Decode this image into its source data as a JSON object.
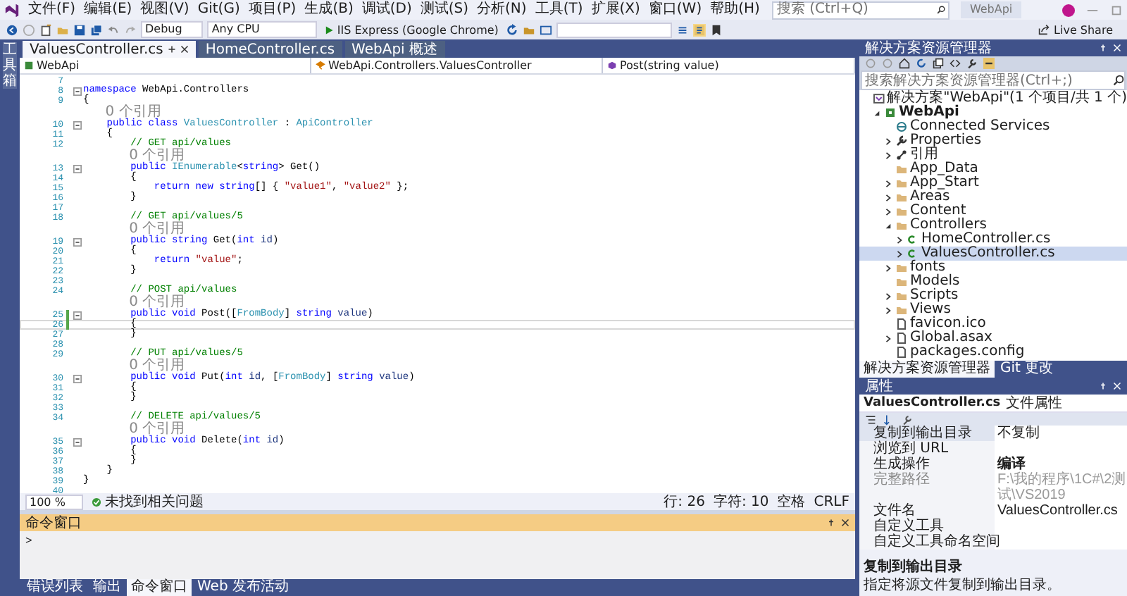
{
  "menu": [
    "文件(F)",
    "编辑(E)",
    "视图(V)",
    "Git(G)",
    "项目(P)",
    "生成(B)",
    "调试(D)",
    "测试(S)",
    "分析(N)",
    "工具(T)",
    "扩展(X)",
    "窗口(W)",
    "帮助(H)"
  ],
  "search": {
    "placeholder": "搜索 (Ctrl+Q)"
  },
  "window": {
    "title": "WebApi"
  },
  "toolbar": {
    "configuration": "Debug",
    "platform": "Any CPU",
    "run_target": "IIS Express (Google Chrome)",
    "live_share": "Live Share"
  },
  "side_tab": "工具箱",
  "tabs": [
    {
      "label": "ValuesController.cs",
      "selected": true
    },
    {
      "label": "HomeController.cs",
      "selected": false
    },
    {
      "label": "WebApi 概述",
      "selected": false
    }
  ],
  "nav": {
    "project": "WebApi",
    "type": "WebApi.Controllers.ValuesController",
    "member": "Post(string value)"
  },
  "code": [
    {
      "kind": "code",
      "number": "7",
      "fold": false,
      "changed": false,
      "current": false
    },
    {
      "kind": "code",
      "number": "8",
      "fold": true,
      "changed": false,
      "current": false,
      "parts": [
        {
          "kind": "keyword",
          "text": "namespace"
        },
        {
          "kind": "plain",
          "text": " WebApi.Controllers"
        }
      ]
    },
    {
      "kind": "code",
      "number": "9",
      "fold": false,
      "changed": false,
      "current": false,
      "parts": [
        {
          "kind": "plain",
          "text": "{"
        }
      ]
    },
    {
      "kind": "lens",
      "text": "0 个引用"
    },
    {
      "kind": "code",
      "number": "10",
      "fold": true,
      "changed": false,
      "current": false,
      "parts": [
        {
          "kind": "keyword",
          "text": "public class "
        },
        {
          "kind": "type",
          "text": "ValuesController"
        },
        {
          "kind": "plain",
          "text": " : "
        },
        {
          "kind": "type",
          "text": "ApiController"
        }
      ]
    },
    {
      "kind": "code",
      "number": "11",
      "fold": false,
      "changed": false,
      "current": false,
      "parts": [
        {
          "kind": "plain",
          "text": "{"
        }
      ]
    },
    {
      "kind": "code",
      "number": "12",
      "fold": false,
      "changed": false,
      "current": false,
      "parts": [
        {
          "kind": "comment",
          "text": "// GET api/values"
        }
      ]
    },
    {
      "kind": "lens",
      "text": "0 个引用"
    },
    {
      "kind": "code",
      "number": "13",
      "fold": true,
      "changed": false,
      "current": false,
      "parts": [
        {
          "kind": "keyword",
          "text": "public "
        },
        {
          "kind": "type",
          "text": "IEnumerable"
        },
        {
          "kind": "plain",
          "text": "<"
        },
        {
          "kind": "keyword",
          "text": "string"
        },
        {
          "kind": "plain",
          "text": "> Get()"
        }
      ]
    },
    {
      "kind": "code",
      "number": "14",
      "fold": false,
      "changed": false,
      "current": false,
      "parts": [
        {
          "kind": "plain",
          "text": "{"
        }
      ]
    },
    {
      "kind": "code",
      "number": "15",
      "fold": false,
      "changed": false,
      "current": false,
      "parts": [
        {
          "kind": "keyword",
          "text": "return new string"
        },
        {
          "kind": "plain",
          "text": "[] { "
        },
        {
          "kind": "string",
          "text": "\"value1\""
        },
        {
          "kind": "plain",
          "text": ", "
        },
        {
          "kind": "string",
          "text": "\"value2\""
        },
        {
          "kind": "plain",
          "text": " };"
        }
      ]
    },
    {
      "kind": "code",
      "number": "16",
      "fold": false,
      "changed": false,
      "current": false,
      "parts": [
        {
          "kind": "plain",
          "text": "}"
        }
      ]
    },
    {
      "kind": "code",
      "number": "17",
      "fold": false,
      "changed": false,
      "current": false
    },
    {
      "kind": "code",
      "number": "18",
      "fold": false,
      "changed": false,
      "current": false,
      "parts": [
        {
          "kind": "comment",
          "text": "// GET api/values/5"
        }
      ]
    },
    {
      "kind": "lens",
      "text": "0 个引用"
    },
    {
      "kind": "code",
      "number": "19",
      "fold": true,
      "changed": false,
      "current": false,
      "parts": [
        {
          "kind": "keyword",
          "text": "public string "
        },
        {
          "kind": "plain",
          "text": "Get("
        },
        {
          "kind": "keyword",
          "text": "int "
        },
        {
          "kind": "param",
          "text": "id"
        },
        {
          "kind": "plain",
          "text": ")"
        }
      ]
    },
    {
      "kind": "code",
      "number": "20",
      "fold": false,
      "changed": false,
      "current": false,
      "parts": [
        {
          "kind": "plain",
          "text": "{"
        }
      ]
    },
    {
      "kind": "code",
      "number": "21",
      "fold": false,
      "changed": false,
      "current": false,
      "parts": [
        {
          "kind": "keyword",
          "text": "return "
        },
        {
          "kind": "string",
          "text": "\"value\""
        },
        {
          "kind": "plain",
          "text": ";"
        }
      ]
    },
    {
      "kind": "code",
      "number": "22",
      "fold": false,
      "changed": false,
      "current": false,
      "parts": [
        {
          "kind": "plain",
          "text": "}"
        }
      ]
    },
    {
      "kind": "code",
      "number": "23",
      "fold": false,
      "changed": false,
      "current": false
    },
    {
      "kind": "code",
      "number": "24",
      "fold": false,
      "changed": false,
      "current": false,
      "parts": [
        {
          "kind": "comment",
          "text": "// POST api/values"
        }
      ]
    },
    {
      "kind": "lens",
      "text": "0 个引用"
    },
    {
      "kind": "code",
      "number": "25",
      "fold": true,
      "changed": true,
      "current": false,
      "parts": [
        {
          "kind": "keyword",
          "text": "public void "
        },
        {
          "kind": "plain",
          "text": "Post(["
        },
        {
          "kind": "type",
          "text": "FromBody"
        },
        {
          "kind": "plain",
          "text": "] "
        },
        {
          "kind": "keyword",
          "text": "string "
        },
        {
          "kind": "param",
          "text": "value"
        },
        {
          "kind": "plain",
          "text": ")"
        }
      ]
    },
    {
      "kind": "code",
      "number": "26",
      "fold": false,
      "changed": true,
      "current": true,
      "parts": [
        {
          "kind": "plain",
          "text": "{"
        }
      ]
    },
    {
      "kind": "code",
      "number": "27",
      "fold": false,
      "changed": false,
      "current": false,
      "parts": [
        {
          "kind": "plain",
          "text": "}"
        }
      ]
    },
    {
      "kind": "code",
      "number": "28",
      "fold": false,
      "changed": false,
      "current": false
    },
    {
      "kind": "code",
      "number": "29",
      "fold": false,
      "changed": false,
      "current": false,
      "parts": [
        {
          "kind": "comment",
          "text": "// PUT api/values/5"
        }
      ]
    },
    {
      "kind": "lens",
      "text": "0 个引用"
    },
    {
      "kind": "code",
      "number": "30",
      "fold": true,
      "changed": false,
      "current": false,
      "parts": [
        {
          "kind": "keyword",
          "text": "public void "
        },
        {
          "kind": "plain",
          "text": "Put("
        },
        {
          "kind": "keyword",
          "text": "int "
        },
        {
          "kind": "param",
          "text": "id"
        },
        {
          "kind": "plain",
          "text": ", ["
        },
        {
          "kind": "type",
          "text": "FromBody"
        },
        {
          "kind": "plain",
          "text": "] "
        },
        {
          "kind": "keyword",
          "text": "string "
        },
        {
          "kind": "param",
          "text": "value"
        },
        {
          "kind": "plain",
          "text": ")"
        }
      ]
    },
    {
      "kind": "code",
      "number": "31",
      "fold": false,
      "changed": false,
      "current": false,
      "parts": [
        {
          "kind": "plain",
          "text": "{"
        }
      ]
    },
    {
      "kind": "code",
      "number": "32",
      "fold": false,
      "changed": false,
      "current": false,
      "parts": [
        {
          "kind": "plain",
          "text": "}"
        }
      ]
    },
    {
      "kind": "code",
      "number": "33",
      "fold": false,
      "changed": false,
      "current": false
    },
    {
      "kind": "code",
      "number": "34",
      "fold": false,
      "changed": false,
      "current": false,
      "parts": [
        {
          "kind": "comment",
          "text": "// DELETE api/values/5"
        }
      ]
    },
    {
      "kind": "lens",
      "text": "0 个引用"
    },
    {
      "kind": "code",
      "number": "35",
      "fold": true,
      "changed": false,
      "current": false,
      "parts": [
        {
          "kind": "keyword",
          "text": "public void "
        },
        {
          "kind": "plain",
          "text": "Delete("
        },
        {
          "kind": "keyword",
          "text": "int "
        },
        {
          "kind": "param",
          "text": "id"
        },
        {
          "kind": "plain",
          "text": ")"
        }
      ]
    },
    {
      "kind": "code",
      "number": "36",
      "fold": false,
      "changed": false,
      "current": false,
      "parts": [
        {
          "kind": "plain",
          "text": "{"
        }
      ]
    },
    {
      "kind": "code",
      "number": "37",
      "fold": false,
      "changed": false,
      "current": false,
      "parts": [
        {
          "kind": "plain",
          "text": "}"
        }
      ]
    },
    {
      "kind": "code",
      "number": "38",
      "fold": false,
      "changed": false,
      "current": false,
      "parts": [
        {
          "kind": "plain",
          "text": "}"
        }
      ]
    },
    {
      "kind": "code",
      "number": "39",
      "fold": false,
      "changed": false,
      "current": false,
      "parts": [
        {
          "kind": "plain",
          "text": "}"
        }
      ]
    },
    {
      "kind": "code",
      "number": "40",
      "fold": false,
      "changed": false,
      "current": false
    }
  ],
  "status": {
    "zoom": "100 %",
    "issues": "未找到相关问题",
    "line": "行: 26",
    "column": "字符: 10",
    "indent": "空格",
    "line_ending": "CRLF"
  },
  "command_window": {
    "title": "命令窗口",
    "prompt": ">"
  },
  "bottom_tabs": [
    {
      "label": "错误列表",
      "selected": false
    },
    {
      "label": "输出",
      "selected": false
    },
    {
      "label": "命令窗口",
      "selected": true
    },
    {
      "label": "Web 发布活动",
      "selected": false
    }
  ],
  "solution_explorer": {
    "title": "解决方案资源管理器",
    "search": {
      "placeholder": "搜索解决方案资源管理器(Ctrl+;)"
    },
    "tree": [
      {
        "label": "解决方案\"WebApi\"(1 个项目/共 1 个)",
        "kind": "solution",
        "selected": false,
        "children": [
          {
            "label": "WebApi",
            "kind": "project",
            "expanded": true,
            "selected": false,
            "children": [
              {
                "label": "Connected Services",
                "kind": "service",
                "selected": false
              },
              {
                "label": "Properties",
                "kind": "wrench",
                "expanded": false,
                "selected": false
              },
              {
                "label": "引用",
                "kind": "references",
                "expanded": false,
                "selected": false
              },
              {
                "label": "App_Data",
                "kind": "folder",
                "selected": false
              },
              {
                "label": "App_Start",
                "kind": "folder",
                "expanded": false,
                "selected": false
              },
              {
                "label": "Areas",
                "kind": "folder",
                "expanded": false,
                "selected": false
              },
              {
                "label": "Content",
                "kind": "folder",
                "expanded": false,
                "selected": false
              },
              {
                "label": "Controllers",
                "kind": "folder",
                "expanded": true,
                "selected": false,
                "children": [
                  {
                    "label": "HomeController.cs",
                    "kind": "csharp",
                    "expanded": false,
                    "selected": false
                  },
                  {
                    "label": "ValuesController.cs",
                    "kind": "csharp",
                    "expanded": false,
                    "selected": true
                  }
                ]
              },
              {
                "label": "fonts",
                "kind": "folder",
                "expanded": false,
                "selected": false
              },
              {
                "label": "Models",
                "kind": "folder",
                "selected": false
              },
              {
                "label": "Scripts",
                "kind": "folder",
                "expanded": false,
                "selected": false
              },
              {
                "label": "Views",
                "kind": "folder",
                "expanded": false,
                "selected": false
              },
              {
                "label": "favicon.ico",
                "kind": "file",
                "selected": false
              },
              {
                "label": "Global.asax",
                "kind": "file",
                "expanded": false,
                "selected": false
              },
              {
                "label": "packages.config",
                "kind": "file",
                "selected": false
              }
            ]
          }
        ]
      }
    ],
    "tabs": [
      {
        "label": "解决方案资源管理器",
        "selected": true
      },
      {
        "label": "Git 更改",
        "selected": false
      }
    ]
  },
  "properties": {
    "title": "属性",
    "object": "ValuesController.cs",
    "object_type": "文件属性",
    "rows": [
      {
        "name": "复制到输出目录",
        "value": "不复制",
        "selected": true,
        "disabled": false,
        "non_default": false
      },
      {
        "name": "浏览到 URL",
        "selected": false,
        "disabled": false
      },
      {
        "name": "生成操作",
        "value": "编译",
        "selected": false,
        "disabled": false,
        "non_default": true
      },
      {
        "name": "完整路径",
        "value": "F:\\我的程序\\1C#\\2测试\\VS2019",
        "selected": false,
        "disabled": true,
        "non_default": false
      },
      {
        "name": "文件名",
        "value": "ValuesController.cs",
        "selected": false,
        "disabled": false,
        "non_default": false
      },
      {
        "name": "自定义工具",
        "selected": false,
        "disabled": false
      },
      {
        "name": "自定义工具命名空间",
        "selected": false,
        "disabled": false
      }
    ],
    "description": {
      "title": "复制到输出目录",
      "text": "指定将源文件复制到输出目录。"
    }
  }
}
